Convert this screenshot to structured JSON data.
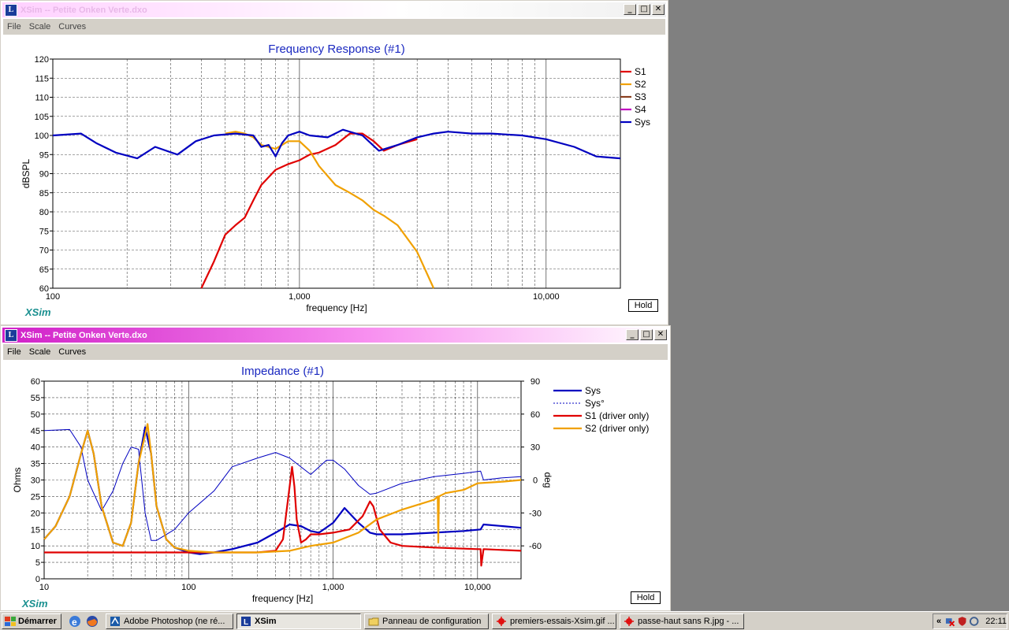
{
  "window1": {
    "title": "XSim -- Petite Onken Verte.dxo",
    "menu": [
      "File",
      "Scale",
      "Curves"
    ],
    "hold_label": "Hold",
    "logo": "XSim"
  },
  "window2": {
    "title": "XSim -- Petite Onken Verte.dxo",
    "menu": [
      "File",
      "Scale",
      "Curves"
    ],
    "hold_label": "Hold",
    "logo": "XSim"
  },
  "chart_data": [
    {
      "type": "line",
      "title": "Frequency Response (#1)",
      "xlabel": "frequency [Hz]",
      "ylabel": "dBSPL",
      "x_scale": "log",
      "xlim": [
        100,
        20000
      ],
      "ylim": [
        60,
        120
      ],
      "x_tick_labels": [
        "100",
        "1,000",
        "10,000"
      ],
      "y_ticks": [
        60,
        65,
        70,
        75,
        80,
        85,
        90,
        95,
        100,
        105,
        110,
        115,
        120
      ],
      "grid": true,
      "legend_position": "right",
      "series": [
        {
          "name": "S1",
          "color": "#e00000",
          "x": [
            400,
            450,
            500,
            550,
            600,
            650,
            700,
            800,
            900,
            1000,
            1100,
            1200,
            1400,
            1600,
            1800,
            2000,
            2200,
            2500,
            3000
          ],
          "y": [
            60,
            67,
            74,
            76.5,
            78.5,
            83,
            87,
            91,
            92.5,
            93.5,
            95,
            95.5,
            97.5,
            100.5,
            100.5,
            98.5,
            96,
            97.5,
            99
          ]
        },
        {
          "name": "S2",
          "color": "#f0a000",
          "x": [
            500,
            550,
            600,
            650,
            700,
            800,
            900,
            1000,
            1100,
            1200,
            1400,
            1600,
            1800,
            2000,
            2200,
            2500,
            3000,
            3500
          ],
          "y": [
            100.5,
            101,
            100.5,
            99.5,
            97.5,
            96.5,
            98.5,
            98.5,
            96,
            92,
            87,
            85,
            83,
            80.5,
            79,
            76.5,
            69.5,
            60
          ]
        },
        {
          "name": "S3",
          "color": "#8a4020",
          "x": [],
          "y": []
        },
        {
          "name": "S4",
          "color": "#c000c0",
          "x": [],
          "y": []
        },
        {
          "name": "Sys",
          "color": "#0000c0",
          "x": [
            100,
            130,
            150,
            180,
            220,
            260,
            320,
            380,
            450,
            550,
            650,
            700,
            750,
            800,
            850,
            900,
            1000,
            1100,
            1300,
            1500,
            1800,
            2100,
            2500,
            3000,
            3500,
            4000,
            5000,
            6000,
            8000,
            10000,
            13000,
            16000,
            20000
          ],
          "y": [
            100,
            100.5,
            98,
            95.5,
            94,
            97,
            95,
            98.5,
            100,
            100.5,
            100,
            97,
            97.5,
            94.5,
            98,
            100,
            101,
            100,
            99.5,
            101.5,
            100,
            96,
            97.5,
            99.5,
            100.5,
            101,
            100.5,
            100.5,
            100,
            99,
            97,
            94.5,
            94
          ]
        }
      ]
    },
    {
      "type": "line",
      "title": "Impedance (#1)",
      "xlabel": "frequency [Hz]",
      "ylabel": "Ohms",
      "y2label": "deg",
      "x_scale": "log",
      "xlim": [
        10,
        20000
      ],
      "ylim": [
        0,
        60
      ],
      "y2lim": [
        -90,
        90
      ],
      "x_tick_labels": [
        "10",
        "100",
        "1,000",
        "10,000"
      ],
      "y_ticks": [
        0,
        5,
        10,
        15,
        20,
        25,
        30,
        35,
        40,
        45,
        50,
        55,
        60
      ],
      "y2_ticks": [
        90,
        60,
        30,
        0,
        -30,
        -60
      ],
      "grid": true,
      "legend_position": "right",
      "series": [
        {
          "name": "Sys",
          "color": "#0000c0",
          "axis": "left",
          "x": [
            10,
            12,
            15,
            18,
            20,
            22,
            25,
            30,
            35,
            40,
            45,
            50,
            55,
            60,
            70,
            80,
            100,
            120,
            150,
            200,
            300,
            400,
            500,
            600,
            700,
            800,
            1000,
            1200,
            1500,
            1800,
            2000,
            3000,
            5000,
            8000,
            10500,
            11000,
            15000,
            20000
          ],
          "y": [
            12,
            16,
            25,
            38,
            45,
            38,
            22,
            11,
            10,
            17,
            35,
            46,
            38,
            22,
            12,
            9.5,
            8,
            7.5,
            8,
            9,
            11,
            14,
            16.5,
            16,
            14.5,
            14,
            17,
            21.5,
            17,
            14,
            13.5,
            13.5,
            14,
            14.5,
            15,
            16.5,
            16,
            15.5
          ]
        },
        {
          "name": "Sys°",
          "color": "#0000c0",
          "axis": "right",
          "x": [
            10,
            15,
            18,
            20,
            25,
            30,
            35,
            40,
            45,
            50,
            55,
            60,
            80,
            100,
            150,
            200,
            300,
            400,
            500,
            700,
            900,
            1000,
            1200,
            1500,
            1800,
            2000,
            3000,
            5000,
            8000,
            10500,
            11000,
            15000,
            20000
          ],
          "y": [
            45,
            46,
            30,
            0,
            -28,
            -10,
            15,
            30,
            28,
            -30,
            -55,
            -55,
            -45,
            -30,
            -10,
            12,
            20,
            25,
            20,
            5,
            18,
            18,
            10,
            -5,
            -13,
            -12,
            -3,
            3,
            6,
            8,
            0,
            2,
            3
          ]
        },
        {
          "name": "S1 (driver only)",
          "color": "#e00000",
          "axis": "left",
          "x": [
            10,
            100,
            200,
            300,
            400,
            450,
            500,
            520,
            540,
            560,
            600,
            650,
            700,
            800,
            1000,
            1300,
            1600,
            1800,
            1900,
            2100,
            2500,
            3000,
            5000,
            10000,
            10500,
            10600,
            11000,
            20000
          ],
          "y": [
            8,
            8,
            8,
            8,
            8.5,
            12,
            28,
            34,
            28,
            18,
            11,
            12,
            13.5,
            13.5,
            14,
            15,
            19,
            23.5,
            22,
            15,
            11,
            10,
            9.5,
            9,
            9,
            4,
            9,
            8.5
          ]
        },
        {
          "name": "S2 (driver only)",
          "color": "#f0a000",
          "axis": "left",
          "x": [
            10,
            12,
            15,
            18,
            20,
            22,
            25,
            30,
            35,
            40,
            45,
            52,
            55,
            60,
            70,
            80,
            100,
            150,
            200,
            300,
            500,
            700,
            1000,
            1500,
            2000,
            3000,
            5000,
            5300,
            5350,
            5400,
            6000,
            8000,
            10000,
            15000,
            20000
          ],
          "y": [
            12,
            16,
            25,
            38,
            45,
            38,
            22,
            11,
            10,
            17,
            35,
            47,
            38,
            22,
            12,
            9.5,
            8.5,
            8,
            8,
            8,
            8.5,
            10,
            11,
            14,
            18,
            21,
            24,
            25,
            11,
            25,
            26,
            27,
            29,
            29.5,
            30
          ]
        }
      ]
    }
  ],
  "taskbar": {
    "start_label": "Démarrer",
    "buttons": [
      {
        "label": "Adobe Photoshop (ne ré...",
        "icon": "photoshop-icon",
        "active": false
      },
      {
        "label": "XSim",
        "icon": "xsim-icon",
        "active": true
      },
      {
        "label": "Panneau de configuration",
        "icon": "folder-icon",
        "active": false
      },
      {
        "label": "premiers-essais-Xsim.gif ...",
        "icon": "image-icon",
        "active": false
      },
      {
        "label": "passe-haut sans R.jpg - ...",
        "icon": "image-icon",
        "active": false
      }
    ],
    "tray_expand": "«",
    "clock": "22:11"
  }
}
